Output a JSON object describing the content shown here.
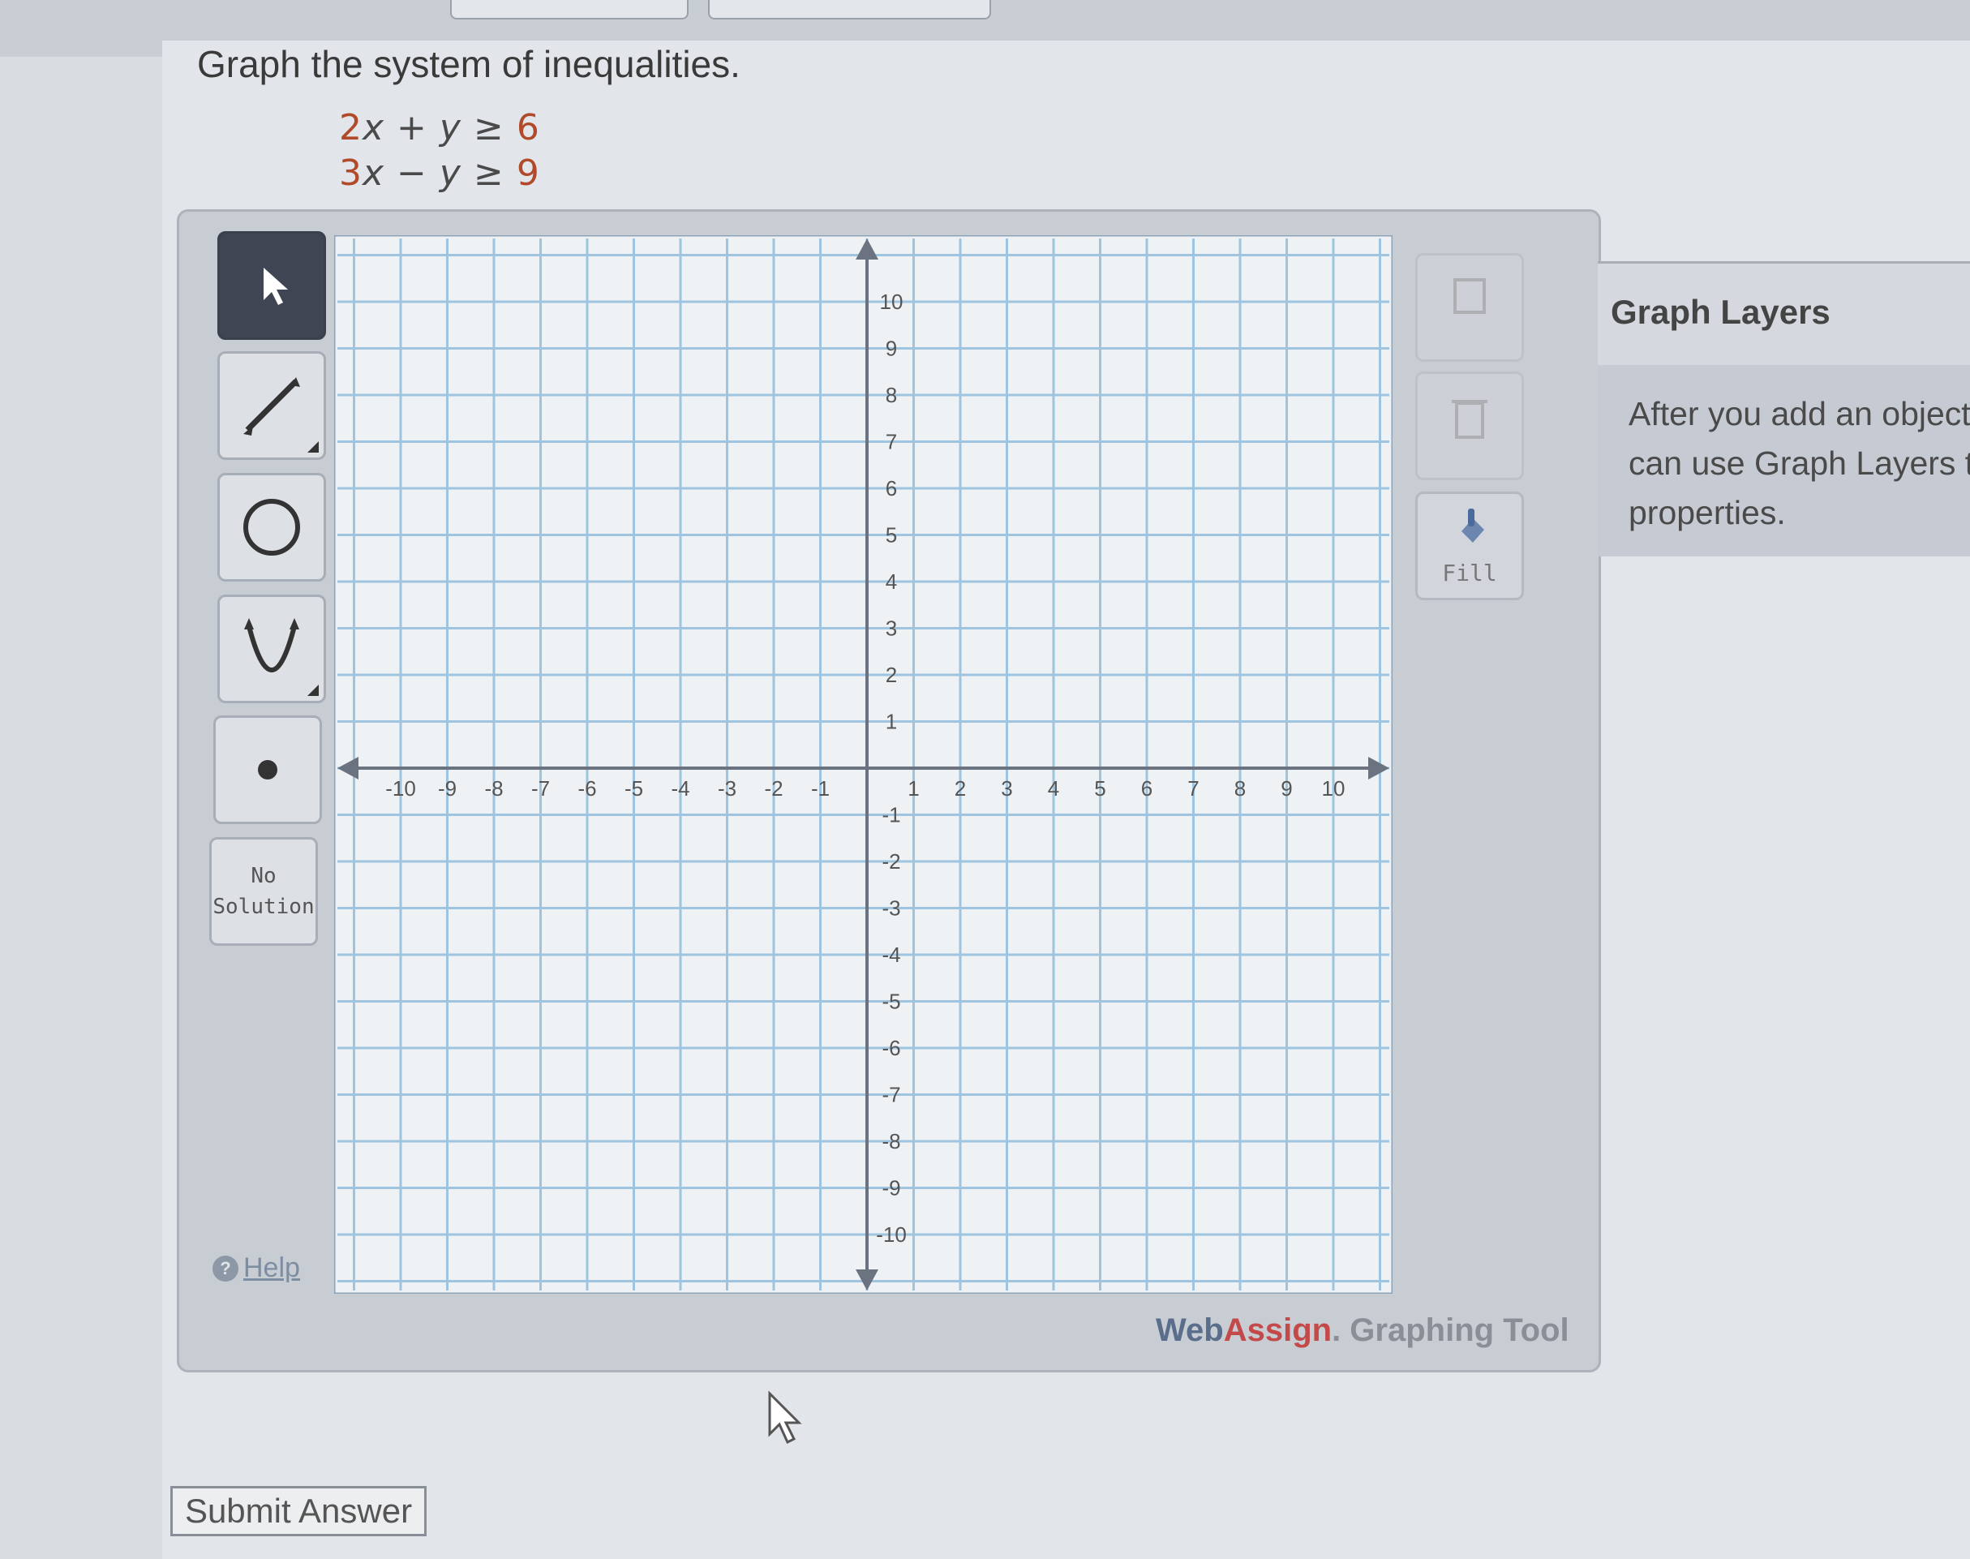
{
  "problem": {
    "title": "Graph the system of inequalities.",
    "ineq1": {
      "a": "2",
      "x": "x",
      "op": "+",
      "y": "y",
      "rel": "≥",
      "c": "6"
    },
    "ineq2": {
      "a": "3",
      "x": "x",
      "op": "−",
      "y": "y",
      "rel": "≥",
      "c": "9"
    }
  },
  "toolbar": {
    "no_solution_line1": "No",
    "no_solution_line2": "Solution",
    "help_label": "Help"
  },
  "side_tools": {
    "fill_label": "Fill"
  },
  "graph": {
    "x_ticks": [
      "-10",
      "-9",
      "-8",
      "-7",
      "-6",
      "-5",
      "-4",
      "-3",
      "-2",
      "-1",
      "1",
      "2",
      "3",
      "4",
      "5",
      "6",
      "7",
      "8",
      "9",
      "10"
    ],
    "y_ticks": [
      "10",
      "9",
      "8",
      "7",
      "6",
      "5",
      "4",
      "3",
      "2",
      "1",
      "-1",
      "-2",
      "-3",
      "-4",
      "-5",
      "-6",
      "-7",
      "-8",
      "-9",
      "-10"
    ]
  },
  "layers": {
    "title": "Graph Layers",
    "text_line1": "After you add an object t",
    "text_line2": "can use Graph Layers to",
    "text_line3": "properties."
  },
  "footer": {
    "brand_web": "Web",
    "brand_assign": "Assign",
    "brand_rest": ". Graphing Tool",
    "submit_label": "Submit Answer"
  },
  "colors": {
    "grid_line": "#9fc4e0",
    "axis": "#6b7380",
    "active_tool": "#3f4552",
    "brand_red": "#c44a4a"
  }
}
